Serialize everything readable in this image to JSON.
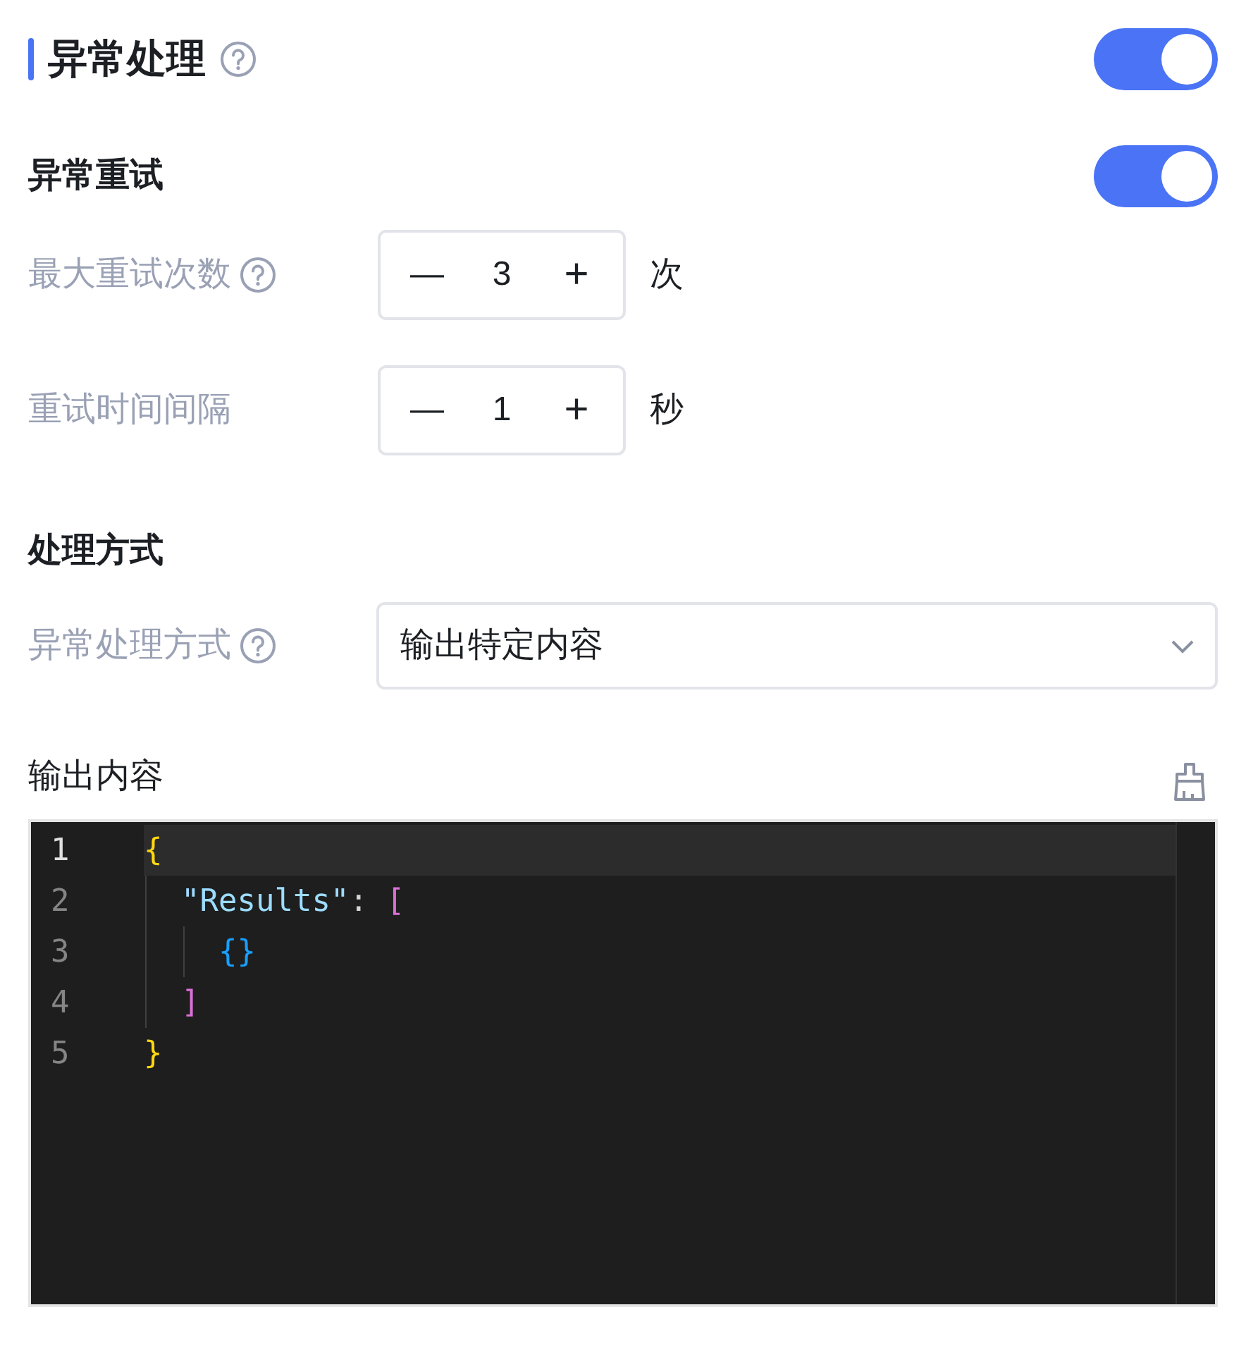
{
  "section": {
    "title": "异常处理",
    "on": true
  },
  "retry": {
    "title": "异常重试",
    "on": true,
    "fields": [
      {
        "label": "最大重试次数",
        "help": true,
        "value": "3",
        "minus": "—",
        "plus": "+",
        "unit": "次"
      },
      {
        "label": "重试时间间隔",
        "help": false,
        "value": "1",
        "minus": "—",
        "plus": "+",
        "unit": "秒"
      }
    ]
  },
  "handling": {
    "title": "处理方式",
    "label": "异常处理方式",
    "select_value": "输出特定内容"
  },
  "output": {
    "title": "输出内容",
    "lines": [
      {
        "number": "1",
        "current": true,
        "tokens": [
          {
            "text": "{",
            "kind": "brace"
          }
        ],
        "children": [
          {
            "number": "2",
            "current": false,
            "tokens": [
              {
                "text": "\"Results\"",
                "kind": "key"
              },
              {
                "text": ":",
                "kind": "punct"
              },
              {
                "text": "[",
                "kind": "bracket"
              }
            ],
            "children": [
              {
                "number": "3",
                "current": false,
                "tokens": [
                  {
                    "text": "{}",
                    "kind": "brace2"
                  }
                ]
              }
            ]
          },
          {
            "number": "4",
            "current": false,
            "tokens": [
              {
                "text": "]",
                "kind": "bracket"
              }
            ]
          }
        ]
      },
      {
        "number": "5",
        "current": false,
        "tokens": [
          {
            "text": "}",
            "kind": "brace"
          }
        ]
      }
    ]
  }
}
